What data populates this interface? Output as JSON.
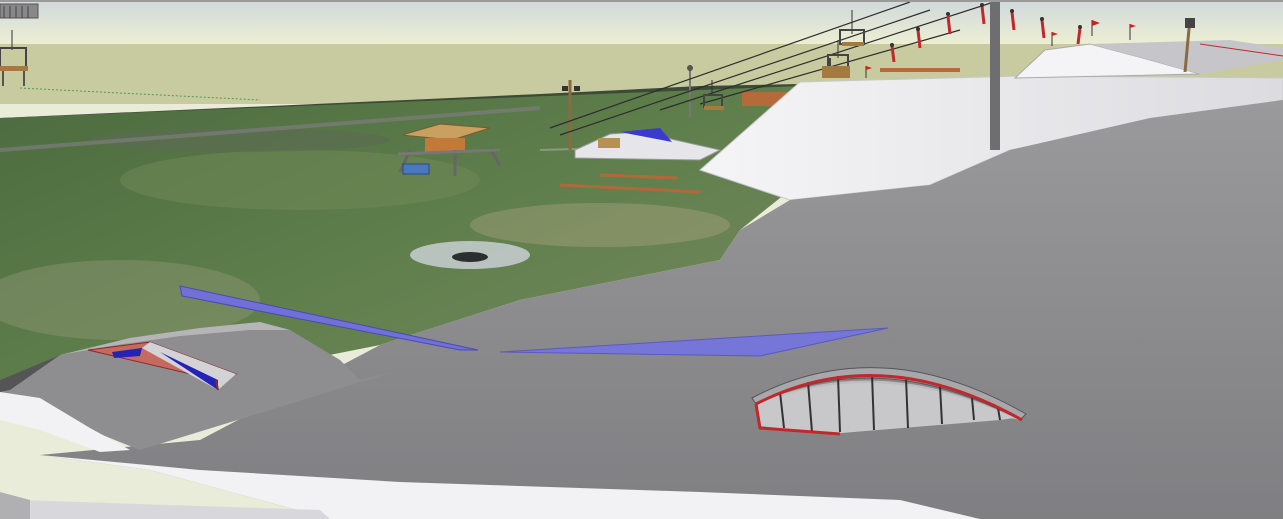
{
  "app": {
    "view": "3d-model-viewport"
  },
  "colors": {
    "sky_top": "#d6dde0",
    "sky_bottom": "#e9eccd",
    "horizon_band": "#c7cc9e",
    "grass": "#5a7a4a",
    "snow_gray": "#8e8e90",
    "snow_white": "#f2f2f4",
    "rail_blue": "#6a6ad8",
    "ramp_red": "#c0282c",
    "wood": "#b88a50",
    "pole_gray": "#6e6e70"
  },
  "scene": {
    "objects": [
      {
        "kind": "chairlift-cable",
        "label": ""
      },
      {
        "kind": "chairlift-chair",
        "label": ""
      },
      {
        "kind": "lift-tower",
        "label": ""
      },
      {
        "kind": "jump-ramp",
        "label": ""
      },
      {
        "kind": "rail",
        "label": ""
      },
      {
        "kind": "quarter-pipe-arch",
        "label": ""
      },
      {
        "kind": "skier-figure",
        "label": ""
      },
      {
        "kind": "flag",
        "label": ""
      },
      {
        "kind": "hut",
        "label": ""
      }
    ]
  }
}
